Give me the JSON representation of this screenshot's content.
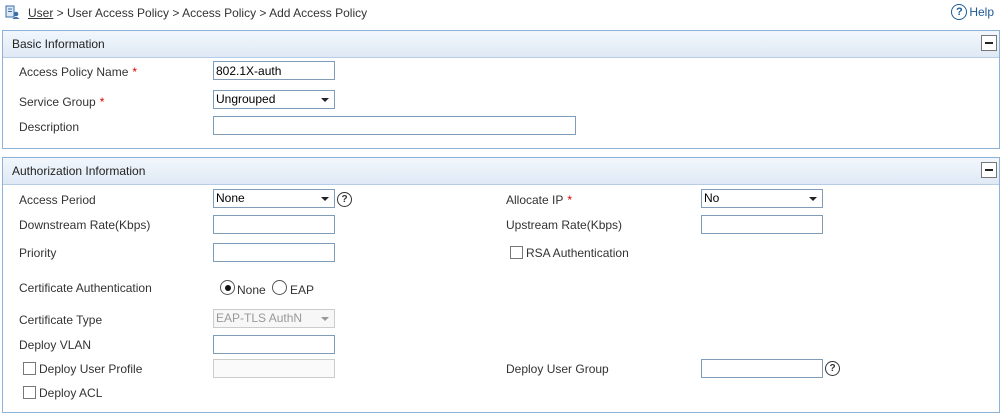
{
  "breadcrumb": {
    "root": "User",
    "rest": " > User Access Policy > Access Policy > Add Access Policy"
  },
  "help_label": "Help",
  "basic": {
    "title": "Basic Information",
    "policy_name_label": "Access Policy Name",
    "policy_name_value": "802.1X-auth",
    "service_group_label": "Service Group",
    "service_group_value": "Ungrouped",
    "description_label": "Description",
    "description_value": "",
    "required_mark": "*"
  },
  "auth": {
    "title": "Authorization Information",
    "access_period_label": "Access Period",
    "access_period_value": "None",
    "allocate_ip_label": "Allocate IP",
    "allocate_ip_value": "No",
    "downstream_label": "Downstream Rate(Kbps)",
    "upstream_label": "Upstream Rate(Kbps)",
    "priority_label": "Priority",
    "rsa_label": "RSA Authentication",
    "cert_auth_label": "Certificate Authentication",
    "cert_auth_options": [
      "None",
      "EAP"
    ],
    "cert_auth_selected": "None",
    "cert_type_label": "Certificate Type",
    "cert_type_value": "EAP-TLS AuthN",
    "deploy_vlan_label": "Deploy VLAN",
    "deploy_user_profile_label": "Deploy User Profile",
    "deploy_user_group_label": "Deploy User Group",
    "deploy_acl_label": "Deploy ACL",
    "required_mark": "*"
  },
  "icons": {
    "collapse": "minus-icon",
    "help": "question-circle-icon",
    "breadcrumb": "user-policy-icon"
  }
}
